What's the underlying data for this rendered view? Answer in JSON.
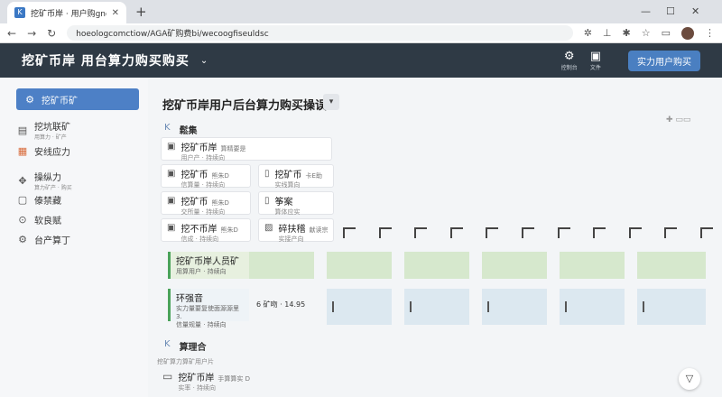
{
  "browser": {
    "tab_title": "挖矿币岸 · 用户购gnoman会 ",
    "url": "hoeologcomctiow/AGA矿购费bi/wecoogfiseuldsc",
    "new_tab": "+",
    "minimize": "—",
    "maximize": "☐",
    "close": "✕"
  },
  "header": {
    "title": "挖矿币岸 用台算力购买购买",
    "icon1_label": "控制台",
    "icon2_label": "文件",
    "buy_button": "实力用户购买"
  },
  "sidebar": {
    "items": [
      {
        "label": "挖矿币矿",
        "sub": "",
        "icon": "gear-icon"
      },
      {
        "label": "挖坑联矿",
        "sub": "用算力 · 矿产",
        "icon": "document-icon"
      },
      {
        "label": "安线应力",
        "sub": "",
        "icon": "grid-icon"
      },
      {
        "label": "操纵力",
        "sub": "算力矿产 · 购买",
        "icon": "cube-icon"
      },
      {
        "label": "傣禁藏",
        "sub": "",
        "icon": "chat-icon"
      },
      {
        "label": "软良赋",
        "sub": "",
        "icon": "globe-icon"
      },
      {
        "label": "台产算丁",
        "sub": "",
        "icon": "settings-icon"
      }
    ]
  },
  "main": {
    "title": "挖矿币岸用户后台算力购买操误",
    "section1": {
      "k": "K",
      "label": "鬆集"
    },
    "section2": {
      "k": "K",
      "label": "算理合"
    },
    "group_label": "挖矿算力算矿用户片",
    "cards": [
      {
        "title": "挖矿币岸",
        "tag": "算精要是",
        "sub": "用户产 · 持续向"
      },
      {
        "title": "挖矿币",
        "tag": "熊朱D",
        "sub": "信算量 · 持续向"
      },
      {
        "title": "挖矿币",
        "tag": "卡E助",
        "sub": "实线算向"
      },
      {
        "title": "挖矿币",
        "tag": "熊朱D",
        "sub": "交所量 · 持续向"
      },
      {
        "title": "筝案",
        "tag": "",
        "sub": "算体应实"
      },
      {
        "title": "挖不币岸",
        "tag": "熊朱D",
        "sub": "信成 · 持续向"
      },
      {
        "title": "碎扶稽",
        "tag": "献读宗",
        "sub": "实接产向"
      }
    ],
    "green_row": {
      "title": "挖矿币岸人员矿",
      "sub": "用算用户 · 持续向"
    },
    "blue_row": {
      "title": "环强音",
      "sub": "实力量要复使面源源里 3.",
      "sub2": "信量规量 · 持续向"
    },
    "spec": "6  矿吻 · 14.95",
    "last_card": {
      "title": "挖矿币岸",
      "tag": "手算算实 D",
      "sub": "实率 · 持续向"
    }
  }
}
